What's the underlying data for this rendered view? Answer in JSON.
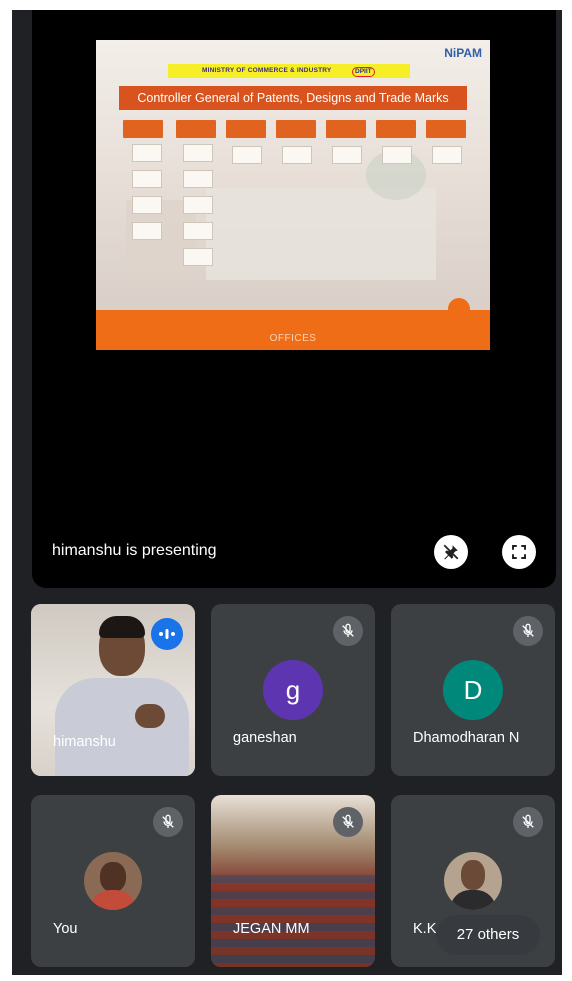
{
  "presentation": {
    "slide": {
      "ministry": "MINISTRY OF COMMERCE & INDUSTRY",
      "dpiit": "DPIIT",
      "logo": "NiPAM",
      "title": "Controller General of Patents, Designs and Trade Marks",
      "footer": "OFFICES"
    },
    "presenting_label": "himanshu is presenting",
    "pin_icon": "pin-off-icon",
    "fullscreen_icon": "fullscreen-icon"
  },
  "participants": [
    {
      "name": "himanshu",
      "type": "video",
      "speaking": true
    },
    {
      "name": "ganeshan",
      "type": "letter",
      "letter": "g",
      "color": "#5e35b1",
      "muted": true
    },
    {
      "name": "Dhamodharan N",
      "type": "letter",
      "letter": "D",
      "color": "#00897b",
      "muted": true
    },
    {
      "name": "You",
      "type": "photo",
      "muted": true
    },
    {
      "name": "JEGAN MM",
      "type": "video",
      "muted": true
    },
    {
      "name": "K.K",
      "type": "photo",
      "muted": true
    }
  ],
  "others_label": "27 others",
  "colors": {
    "background": "#202124",
    "tile": "#3c4043",
    "accent_orange": "#ef6d17",
    "speaking": "#1a73e8"
  }
}
